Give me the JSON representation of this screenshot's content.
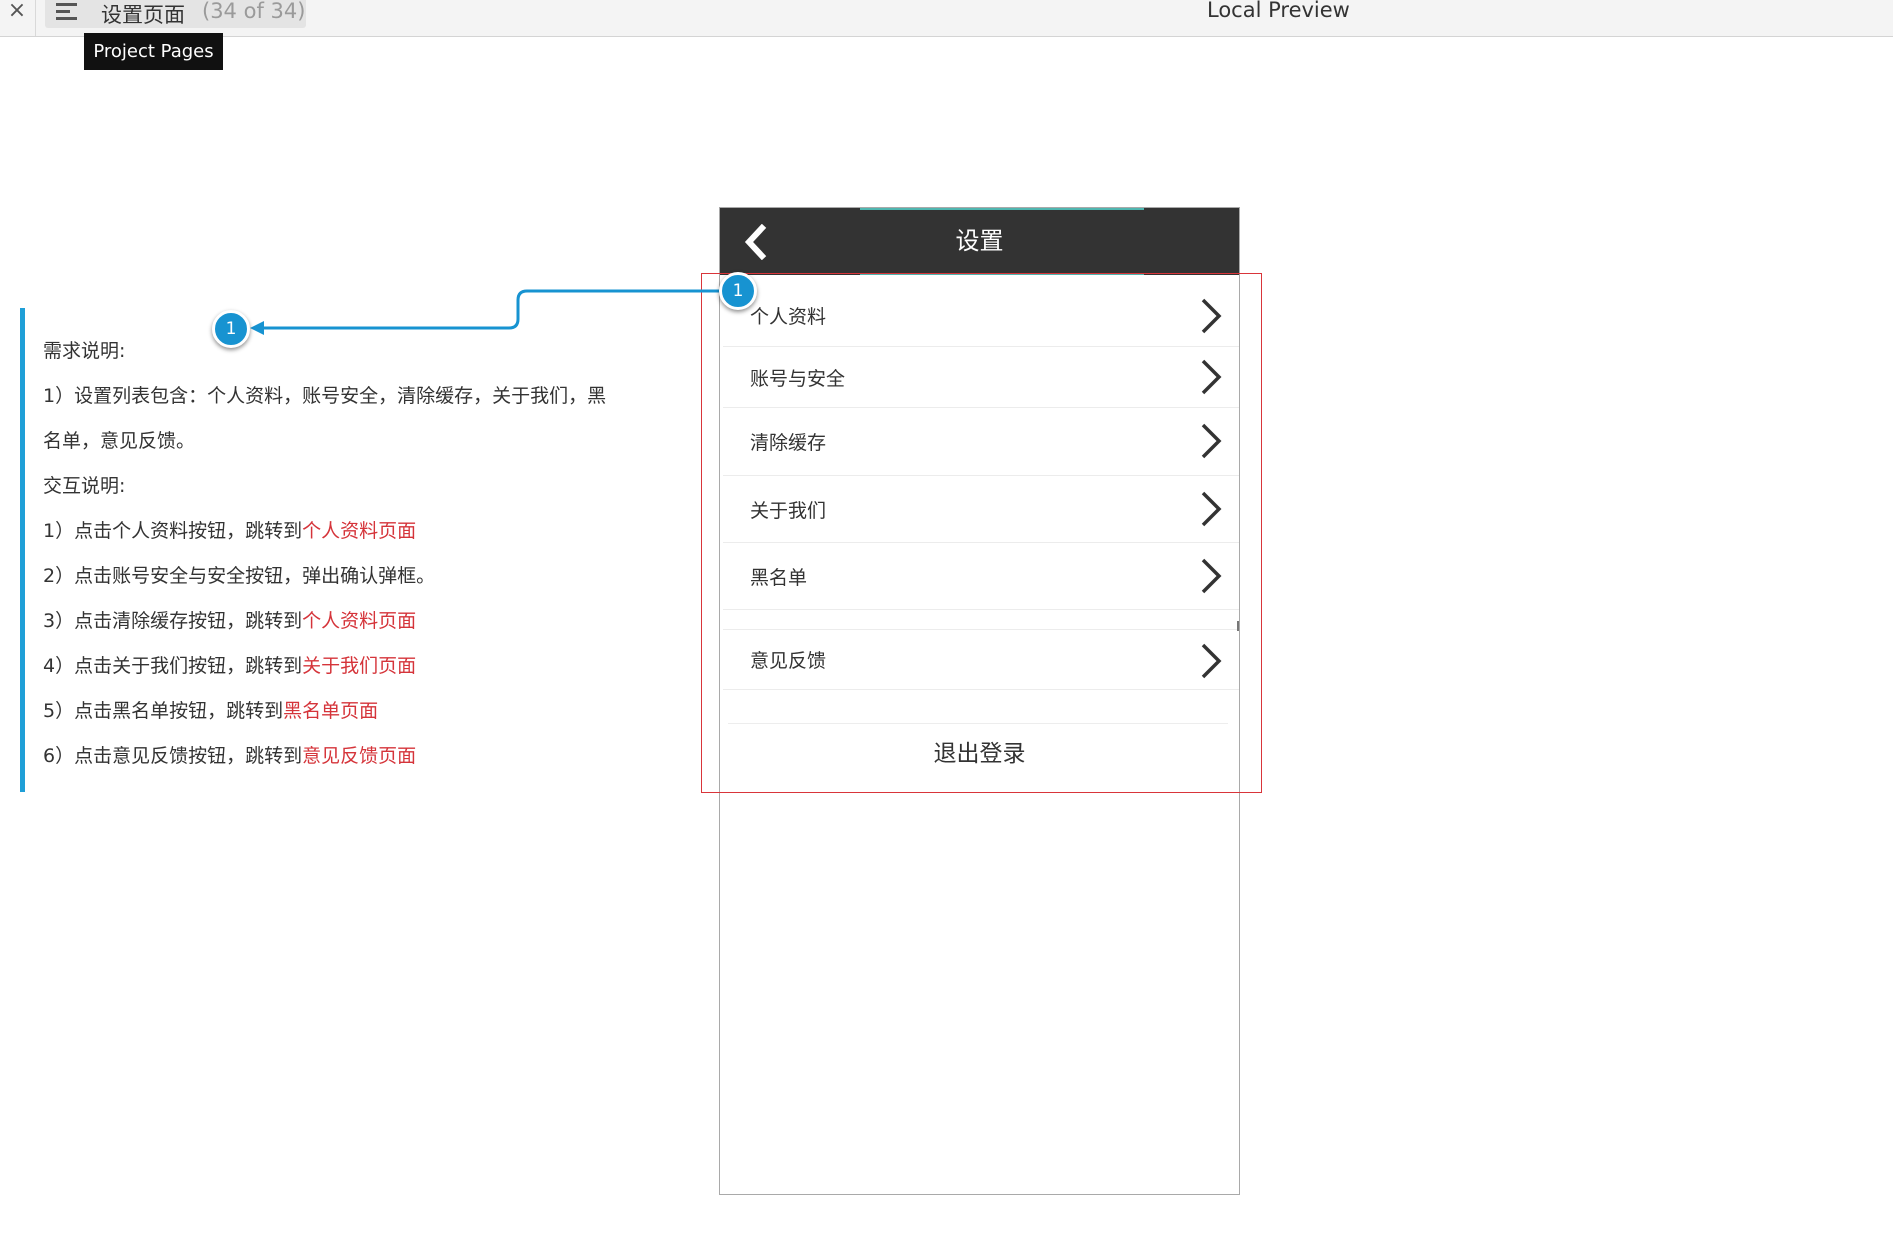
{
  "topbar": {
    "close_glyph": "×",
    "page_name": "设置页面",
    "page_count": "(34 of 34)",
    "window_title": "Local Preview",
    "tooltip": "Project Pages"
  },
  "notes": {
    "lines": [
      {
        "text": "需求说明:",
        "link": ""
      },
      {
        "text": "1）设置列表包含：个人资料，账号安全，清除缓存，关于我们，黑",
        "link": ""
      },
      {
        "text": "名单，意见反馈。",
        "link": ""
      },
      {
        "text": "交互说明:",
        "link": ""
      },
      {
        "text": "1）点击个人资料按钮，跳转到",
        "link": "个人资料页面"
      },
      {
        "text": "2）点击账号安全与安全按钮，弹出确认弹框。",
        "link": ""
      },
      {
        "text": "3）点击清除缓存按钮，跳转到",
        "link": "个人资料页面"
      },
      {
        "text": "4）点击关于我们按钮，跳转到",
        "link": "关于我们页面"
      },
      {
        "text": "5）点击黑名单按钮，跳转到",
        "link": "黑名单页面"
      },
      {
        "text": "6）点击意见反馈按钮，跳转到",
        "link": "意见反馈页面"
      }
    ]
  },
  "callout": {
    "number": "1",
    "color": "#1793d1"
  },
  "phone": {
    "title": "设置",
    "items": [
      {
        "label": "个人资料"
      },
      {
        "label": "账号与安全"
      },
      {
        "label": "清除缓存"
      },
      {
        "label": "关于我们"
      },
      {
        "label": "黑名单"
      },
      {
        "label": "意见反馈"
      }
    ],
    "logout": "退出登录"
  },
  "colors": {
    "header": "#333333",
    "accent": "#4fb6b0",
    "link": "#d5343a",
    "notes_bar": "#1f9fd7",
    "selection": "#d9353a"
  }
}
